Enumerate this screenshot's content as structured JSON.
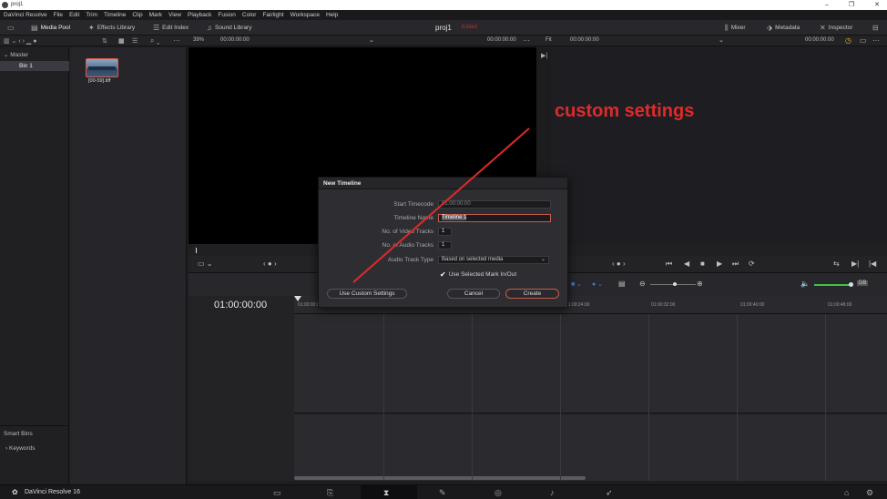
{
  "window": {
    "title": "proj1",
    "controls": [
      "–",
      "❐",
      "✕"
    ]
  },
  "menu": [
    "DaVinci Resolve",
    "File",
    "Edit",
    "Trim",
    "Timeline",
    "Clip",
    "Mark",
    "View",
    "Playback",
    "Fusion",
    "Color",
    "Fairlight",
    "Workspace",
    "Help"
  ],
  "toolbar": {
    "media_pool": "Media Pool",
    "effects_library": "Effects Library",
    "edit_index": "Edit Index",
    "sound_library": "Sound Library",
    "project_name": "proj1",
    "edited": "Edited",
    "mixer": "Mixer",
    "metadata": "Metadata",
    "inspector": "Inspector"
  },
  "subbar": {
    "zoom": "39%",
    "source_tc": "00:00:00:00",
    "source_dur": "00:00:00:00",
    "fit": "Fit",
    "record_tc": "00:00:00:00",
    "record_dur": "00:00:00:00"
  },
  "bins": {
    "master": "Master",
    "bin1": "Bin 1",
    "smart_bins": "Smart Bins",
    "keywords": "Keywords"
  },
  "media": {
    "clip_name": "[00-59].tiff"
  },
  "timeline": {
    "timecode": "01:00:00:00",
    "ruler": [
      "01:00:00:00",
      "01:00:24:00",
      "01:00:32:00",
      "01:00:40:00",
      "01:00:48:00"
    ]
  },
  "dialog": {
    "title": "New Timeline",
    "start_timecode_label": "Start Timecode",
    "start_timecode_value": "01:00:00:00",
    "timeline_name_label": "Timeline Name",
    "timeline_name_value": "Timeline 1",
    "video_tracks_label": "No. of Video Tracks",
    "video_tracks_value": "1",
    "audio_tracks_label": "No. of Audio Tracks",
    "audio_tracks_value": "1",
    "audio_track_type_label": "Audio Track Type",
    "audio_track_type_value": "Based on selected media",
    "use_mark_label": "Use Selected Mark In/Out",
    "use_custom_settings": "Use Custom Settings",
    "cancel": "Cancel",
    "create": "Create"
  },
  "annotation": {
    "text": "custom settings",
    "color": "#e02a2a"
  },
  "statusbar": {
    "app_name": "DaVinci Resolve 16"
  },
  "colors": {
    "accent_red": "#c75a4a",
    "bg": "#1e1e22"
  }
}
